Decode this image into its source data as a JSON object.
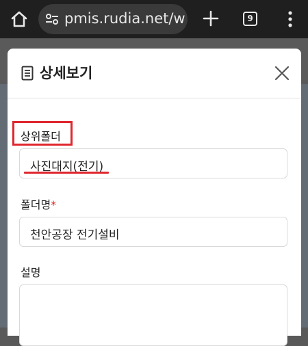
{
  "browser": {
    "url": "pmis.rudia.net/w",
    "tab_count": "9"
  },
  "modal": {
    "title": "상세보기",
    "fields": [
      {
        "label": "상위폴더",
        "required": false,
        "value": "사진대지(전기)"
      },
      {
        "label": "폴더명",
        "required": true,
        "required_mark": "*",
        "value": "천안공장 전기설비"
      },
      {
        "label": "설명",
        "required": false,
        "value": ""
      }
    ]
  },
  "colors": {
    "browser_bar": "#1f1f1f",
    "url_pill": "#3a3a3a",
    "annotation_red": "#e0262e",
    "required_red": "#e02020"
  }
}
